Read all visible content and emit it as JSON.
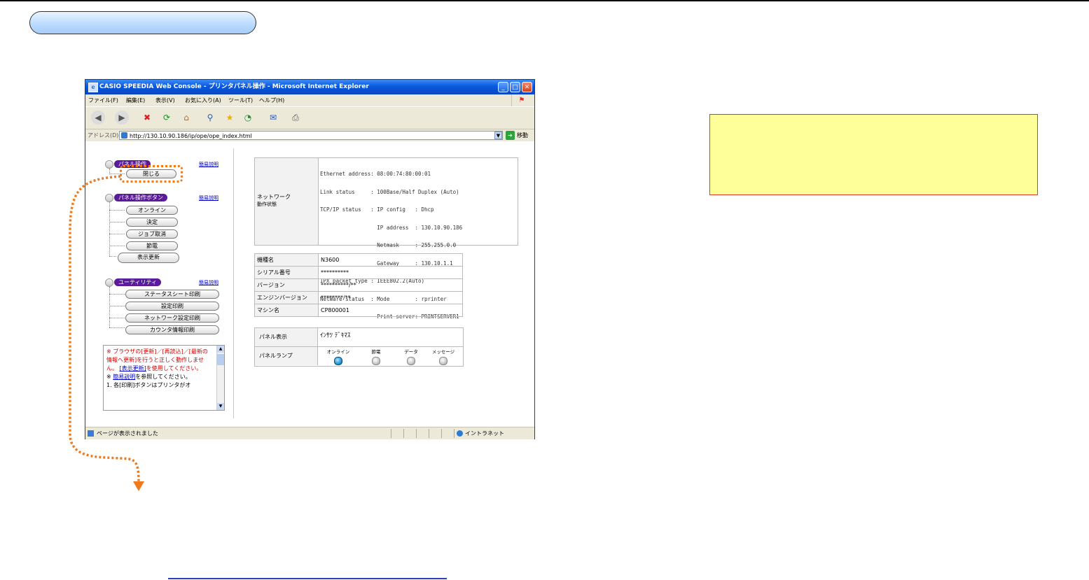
{
  "window": {
    "title": "CASIO SPEEDIA Web Console - プリンタパネル操作 - Microsoft Internet Explorer",
    "menu": [
      "ファイル(F)",
      "編集(E)",
      "表示(V)",
      "お気に入り(A)",
      "ツール(T)",
      "ヘルプ(H)"
    ],
    "address_label": "アドレス(D)",
    "address": "http://130.10.90.186/ip/ope/ope_index.html",
    "go_label": "移動",
    "status_text": "ページが表示されました",
    "zone": "イントラネット"
  },
  "panel": {
    "help_label": "簡易説明",
    "groups": {
      "panel_op": {
        "label": "パネル操作",
        "buttons": [
          "閉じる"
        ]
      },
      "panel_buttons": {
        "label": "パネル操作ボタン",
        "buttons": [
          "オンライン",
          "決定",
          "ジョブ取消",
          "節電",
          "表示更新"
        ]
      },
      "utility": {
        "label": "ユーティリティ",
        "buttons": [
          "ステータスシート印刷",
          "設定印刷",
          "ネットワーク設定印刷",
          "カウンタ情報印刷"
        ]
      }
    },
    "notice": {
      "p1a": "※ ブラウザの[更新]／[再読込]／[最新の情報へ更新]を行うと正しく動作しません。",
      "p1b_link": "[表示更新]",
      "p1c": "を使用してください。",
      "p2a": "※ ",
      "p2_link": "簡易説明",
      "p2b": "を参照してください。",
      "p3": "1. 各[印刷]ボタンはプリンタがオ"
    }
  },
  "network": {
    "label1": "ネットワーク",
    "label2": "動作状態",
    "lines": [
      "Ethernet address: 08:00:74:80:00:01",
      "Link status     : 100Base/Half Duplex (Auto)",
      "TCP/IP status   : IP config   : Dhcp",
      "                  IP address  : 130.10.90.186",
      "                  Netmask     : 255.255.0.0",
      "                  Gateway     : 130.10.1.1",
      "IPX packet type : IEEE802.2(Auto)",
      "NetWare status  : Mode        : rprinter",
      "                  Print server: PRINTSERVER1"
    ]
  },
  "info": [
    {
      "key": "機種名",
      "value": "N3600"
    },
    {
      "key": "シリアル番号",
      "value": "**********"
    },
    {
      "key": "バージョン",
      "value": "**********/**"
    },
    {
      "key": "エンジンバージョン",
      "value": "********/**"
    },
    {
      "key": "マシン名",
      "value": "CP800001"
    }
  ],
  "panel_display": {
    "display_label": "パネル表示",
    "display_text": "ｲﾝｻﾂ ﾃﾞｷﾏｽ",
    "lamp_label": "パネルランプ",
    "lamps": [
      {
        "name": "オンライン",
        "on": true
      },
      {
        "name": "節電",
        "on": false
      },
      {
        "name": "データ",
        "on": false
      },
      {
        "name": "メッセージ",
        "on": false
      }
    ]
  },
  "colors": {
    "callout": "#f07a1a",
    "note_fill": "#ffff99",
    "note_border": "#e23a2a",
    "pill": "#bcdcff",
    "group_label": "#5a1a9a"
  }
}
